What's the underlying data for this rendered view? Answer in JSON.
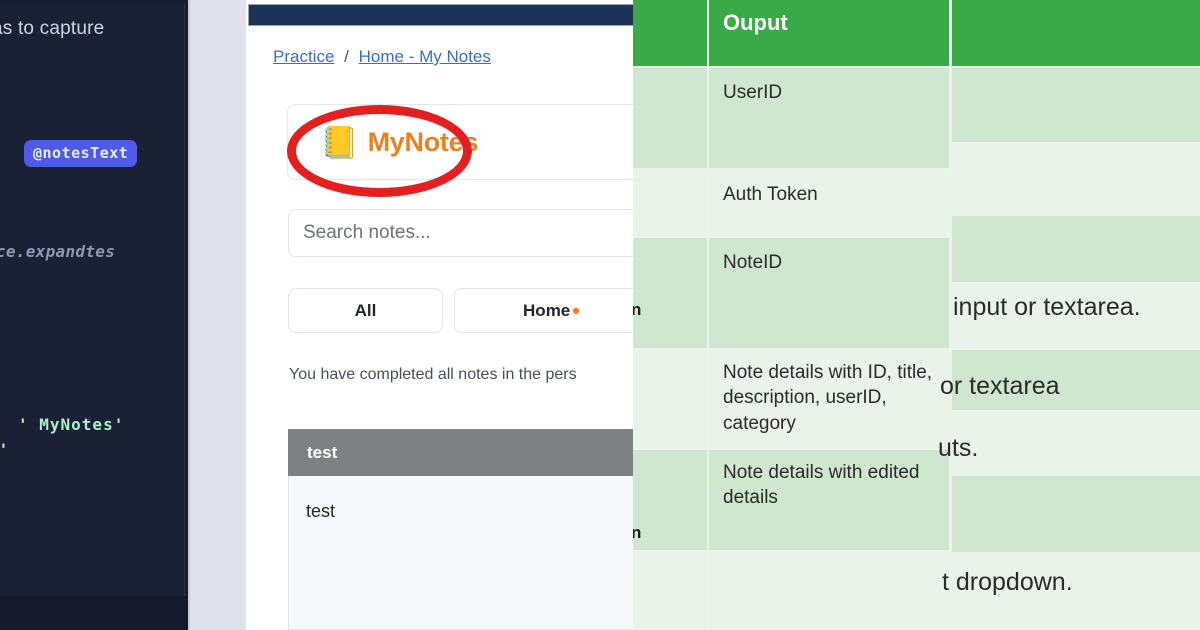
{
  "ide": {
    "top_text_cut": "as to capture",
    "badge": "@notesText",
    "ghost_text": "ice.expandtes",
    "code_line_1": "'   MyNotes'",
    "code_line_2": "s'"
  },
  "app": {
    "breadcrumb": {
      "root": "Practice",
      "separator": "/",
      "current": "Home - My Notes"
    },
    "logo": {
      "emoji": "📒",
      "text": "MyNotes"
    },
    "search": {
      "placeholder": "Search notes...",
      "value": ""
    },
    "filters": [
      {
        "label": "All",
        "dot": ""
      },
      {
        "label": "Home",
        "dot": "•"
      }
    ],
    "status_text": "You have completed all notes in the pers",
    "note": {
      "title": "test",
      "body": "test"
    }
  },
  "table": {
    "header": {
      "col_a": "",
      "col_b": "Ouput",
      "col_c": ""
    },
    "rows": [
      {
        "col_a": "",
        "col_b": "UserID",
        "col_c": ""
      },
      {
        "col_a": "",
        "col_b": "Auth Token",
        "col_c": ""
      },
      {
        "col_a": "",
        "col_b": "NoteID",
        "col_c": ""
      },
      {
        "col_a": "",
        "col_b": "Note details with ID, title, description, userID, category",
        "col_c": ""
      },
      {
        "col_a": "",
        "col_b": "Note details with edited details",
        "col_c": ""
      },
      {
        "col_a": "",
        "col_b": "",
        "col_c": ""
      }
    ],
    "right_fragments": [
      "input or textarea.",
      "or textarea",
      "uts.",
      "t dropdown."
    ],
    "left_fragments": [
      "n",
      "n"
    ]
  },
  "colors": {
    "ide_bg": "#1b2134",
    "badge_bg": "#4f5ae8",
    "code_green": "#a9f0cd",
    "navbar": "#1d3356",
    "brand_orange": "#e8811f",
    "annotation_red": "#e3201f",
    "table_header_green": "#3aa948",
    "band_dark": "#cfe6cf",
    "band_light": "#e9f3e9",
    "note_header_gray": "#7e8184"
  }
}
